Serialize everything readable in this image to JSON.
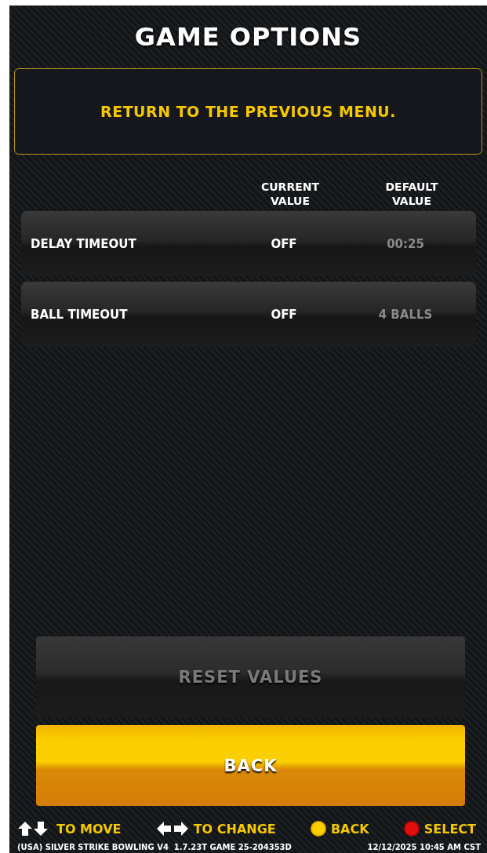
{
  "title": "GAME OPTIONS",
  "info": "RETURN TO THE PREVIOUS MENU.",
  "columns": [
    "CURRENT VALUE",
    "DEFAULT VALUE"
  ],
  "options": [
    {
      "label": "DELAY TIMEOUT",
      "current": "OFF",
      "default": "00:25"
    },
    {
      "label": "BALL TIMEOUT",
      "current": "OFF",
      "default": "4 BALLS"
    }
  ],
  "buttons": [
    {
      "label": "RESET VALUES",
      "selected": false,
      "disabled": true
    },
    {
      "label": "BACK",
      "selected": true,
      "disabled": false
    }
  ],
  "hints": [
    {
      "kind": "updown",
      "label": "TO MOVE"
    },
    {
      "kind": "leftright",
      "label": "TO CHANGE"
    },
    {
      "kind": "yellow-button",
      "label": "BACK"
    },
    {
      "kind": "red-button",
      "label": "SELECT"
    }
  ],
  "footer": {
    "version": "(USA) SILVER STRIKE BOWLING V4  1.7.23T GAME 25-204353D",
    "datetime": "12/12/2025 10:45 AM CST"
  }
}
